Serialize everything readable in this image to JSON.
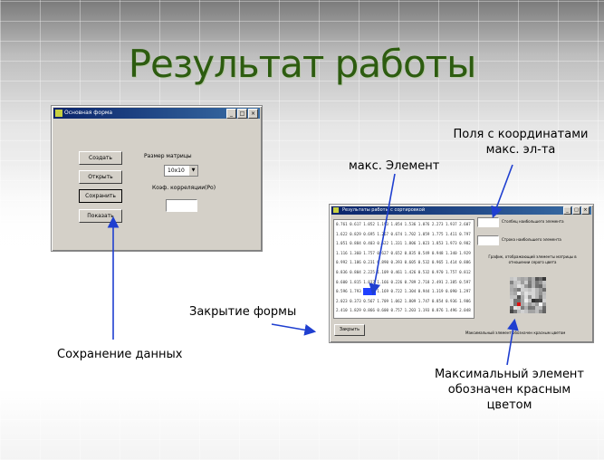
{
  "slide_title": "Результат работы",
  "main_window": {
    "title": "Основная форма",
    "buttons": {
      "create": "Создать",
      "open": "Открыть",
      "save": "Сохранить",
      "show": "Показать"
    },
    "matrix_size_label": "Размер матрицы",
    "matrix_size_value": "10x10",
    "corr_label": "Коэф. корреляции(Ро)",
    "corr_value": ""
  },
  "result_window": {
    "title": "Результаты работы с сортировкой",
    "close_button": "Закрыть",
    "label_coord1": "Столбец наибольшего элемента",
    "label_coord2": "Строка наибольшего элемента",
    "label_graph": "График, отображающий элементы матрицы в отношении серого цвета",
    "label_bottom": "Максимальный элемент обозначен красным цветом",
    "matrix_rows": [
      "0.761 0.617 1.052 1.193 1.054 1.536 1.076 2.273 1.937 2.607",
      "1.622 0.829 0.695 1.267 0.674 1.702 1.059 1.775 1.411 0.797",
      "1.051 0.884 0.403 0.622 1.331 1.806 1.023 1.853 1.973 0.982",
      "1.116 1.360 1.757 0.627 0.652 0.835 0.549 0.948 1.340 1.929",
      "0.992 1.186 0.231 0.890 0.393 0.605 0.532 0.965 1.414 0.886",
      "0.836 0.804 2.225 1.109 0.461 1.426 0.532 0.970 1.757 0.812",
      "0.600 1.815 1.837 1.166 0.226 0.789 2.718 2.491 2.385 0.597",
      "0.596 1.793 2.884 1.169 0.722 1.304 0.944 1.319 0.090 1.297",
      "2.023 0.373 0.567 1.709 1.062 1.809 1.747 0.854 0.936 1.986",
      "2.410 1.829 0.866 0.600 0.757 1.203 1.193 0.876 1.496 2.048"
    ]
  },
  "annotations": {
    "coord_fields": "Поля с координатами макс. эл-та",
    "max_element": "макс. Элемент",
    "close_form": "Закрытие формы",
    "save_data": "Сохранение данных",
    "max_red": "Максимальный элемент обозначен красным цветом"
  },
  "colors": {
    "title_green": "#2d5c10",
    "titlebar_blue": "#0a246a",
    "arrow_blue": "#1f3fd0",
    "highlight_red": "#e01010"
  }
}
